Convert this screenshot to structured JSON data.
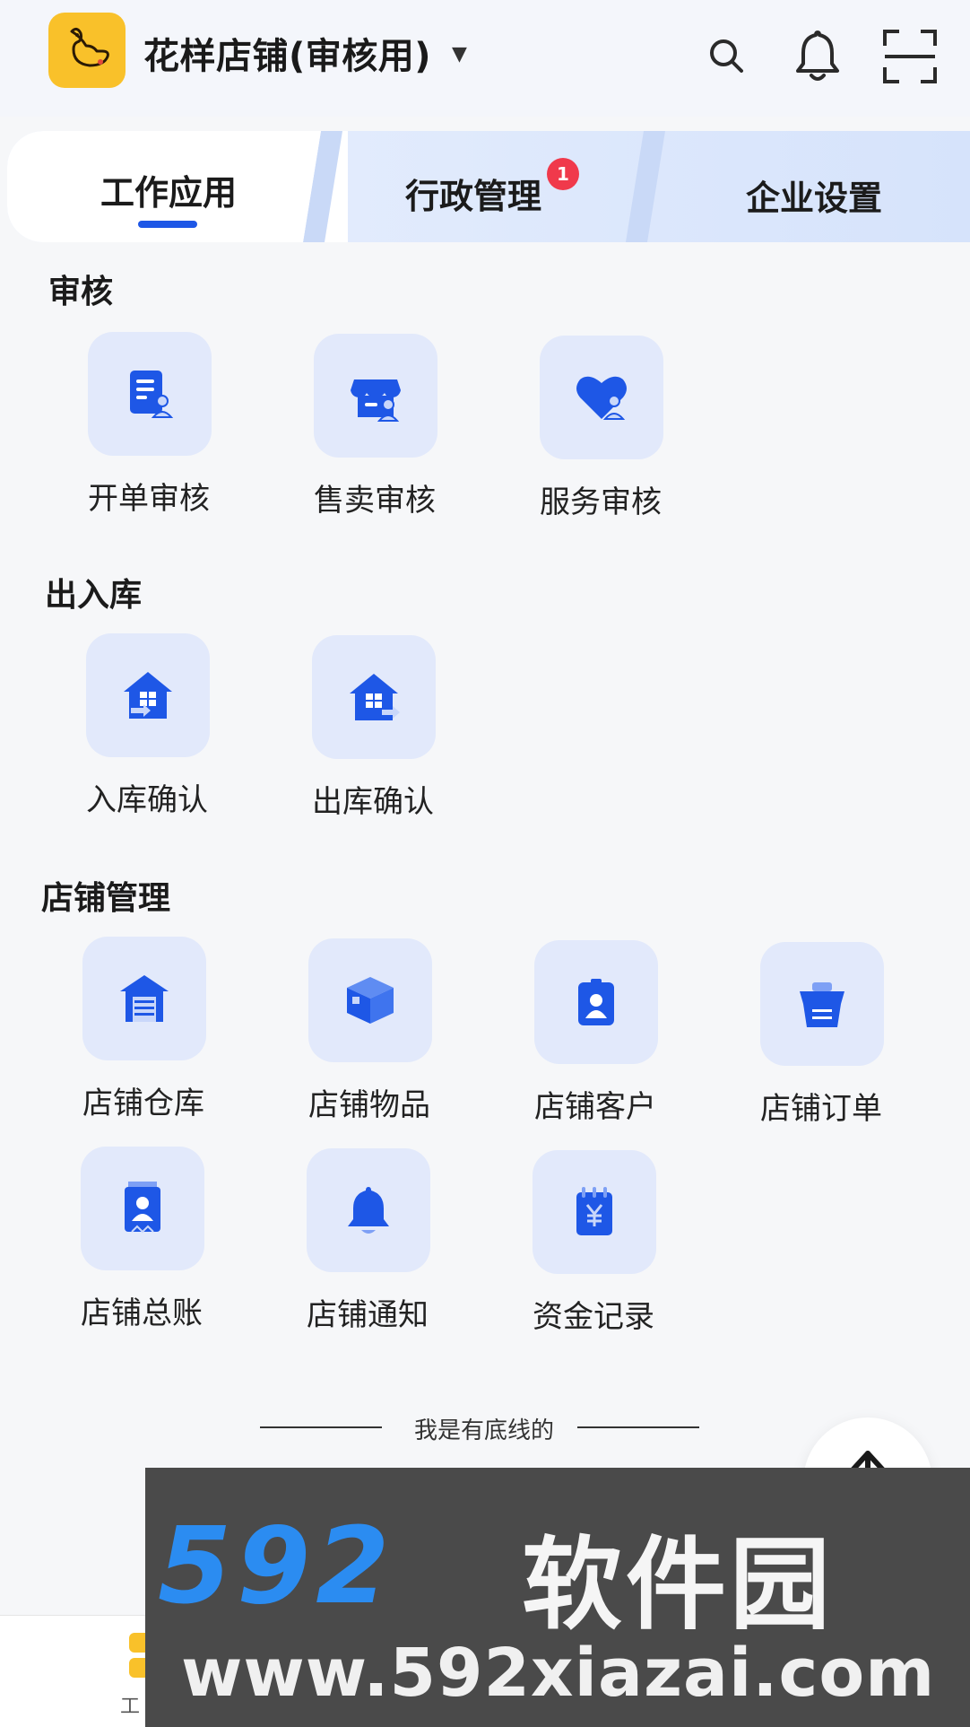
{
  "header": {
    "store_name": "花样店铺(审核用)",
    "dropdown_glyph": "▼",
    "icons": [
      "search-icon",
      "bell-icon",
      "scan-icon"
    ]
  },
  "tabs": [
    {
      "label": "工作应用",
      "active": true
    },
    {
      "label": "行政管理",
      "badge": "1"
    },
    {
      "label": "企业设置"
    }
  ],
  "sections": {
    "review": {
      "title": "审核",
      "items": [
        {
          "label": "开单审核",
          "icon": "order-review-icon"
        },
        {
          "label": "售卖审核",
          "icon": "store-review-icon"
        },
        {
          "label": "服务审核",
          "icon": "service-review-icon"
        }
      ]
    },
    "warehouse": {
      "title": "出入库",
      "items": [
        {
          "label": "入库确认",
          "icon": "inbound-icon"
        },
        {
          "label": "出库确认",
          "icon": "outbound-icon"
        }
      ]
    },
    "store": {
      "title": "店铺管理",
      "items": [
        {
          "label": "店铺仓库",
          "icon": "warehouse-icon"
        },
        {
          "label": "店铺物品",
          "icon": "box-icon"
        },
        {
          "label": "店铺客户",
          "icon": "customer-badge-icon"
        },
        {
          "label": "店铺订单",
          "icon": "order-basket-icon"
        },
        {
          "label": "店铺总账",
          "icon": "ledger-icon"
        },
        {
          "label": "店铺通知",
          "icon": "notification-bell-icon"
        },
        {
          "label": "资金记录",
          "icon": "fund-record-icon"
        }
      ]
    }
  },
  "footer": {
    "baseline_text": "我是有底线的",
    "tabbar_label_partial": "工"
  },
  "watermark": {
    "brand_number": "592",
    "brand_text": "软件园",
    "url": "www.592xiazai.com"
  },
  "colors": {
    "accent": "#1e57e6",
    "tile_bg": "#e2e9fb",
    "logo_bg": "#f9c12a",
    "badge": "#f0394b"
  }
}
